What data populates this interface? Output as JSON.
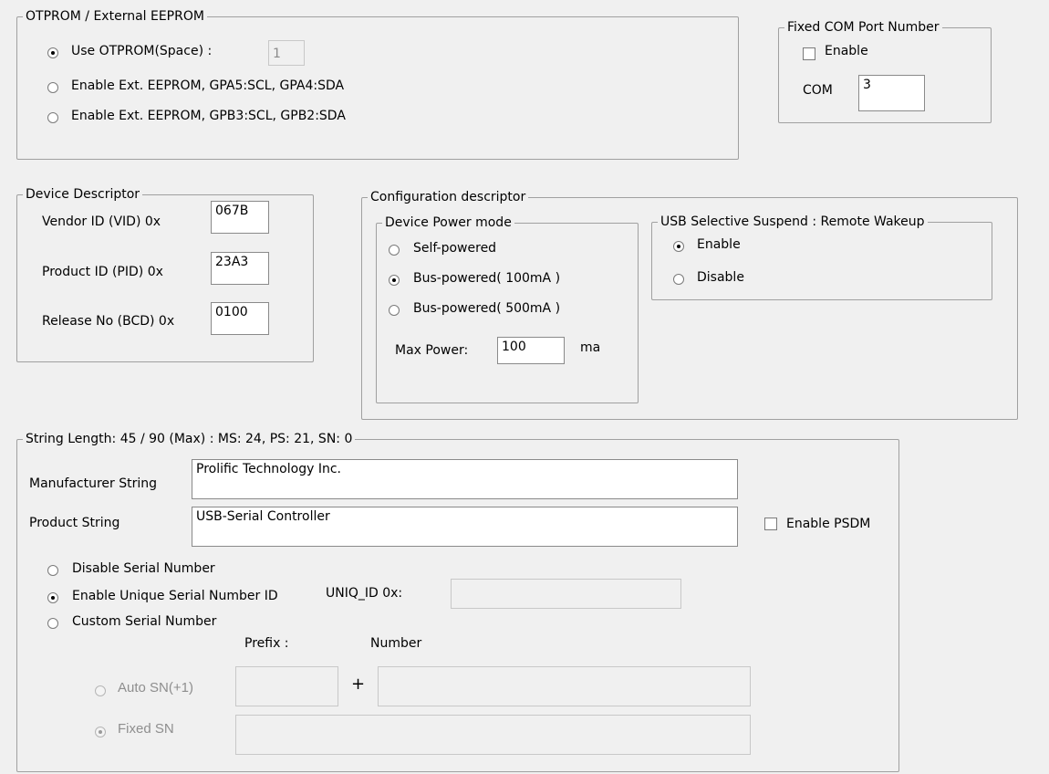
{
  "otprom": {
    "title": "OTPROM / External EEPROM",
    "use_otprom_label": "Use OTPROM(Space) :",
    "space_value": "1",
    "gpa_label": "Enable Ext. EEPROM, GPA5:SCL, GPA4:SDA",
    "gpb_label": "Enable Ext. EEPROM, GPB3:SCL, GPB2:SDA",
    "selected": "use_otprom"
  },
  "com_port": {
    "title": "Fixed COM Port Number",
    "enable_label": "Enable",
    "enabled": false,
    "com_label": "COM",
    "com_value": "3"
  },
  "device_descriptor": {
    "title": "Device Descriptor",
    "vid_label": "Vendor ID (VID)  0x",
    "vid_value": "067B",
    "pid_label": "Product ID (PID)  0x",
    "pid_value": "23A3",
    "bcd_label": "Release No (BCD) 0x",
    "bcd_value": "0100"
  },
  "config_descriptor": {
    "title": "Configuration descriptor",
    "power_mode": {
      "title": "Device Power mode",
      "self_label": "Self-powered",
      "bus100_label": "Bus-powered( 100mA )",
      "bus500_label": "Bus-powered( 500mA )",
      "selected": "bus100",
      "max_power_label": "Max Power:",
      "max_power_value": "100",
      "unit": "ma"
    },
    "suspend": {
      "title": "USB Selective Suspend : Remote Wakeup",
      "enable_label": "Enable",
      "disable_label": "Disable",
      "selected": "enable"
    }
  },
  "strings": {
    "title": "String Length: 45 / 90 (Max) :  MS: 24, PS: 21, SN: 0",
    "manufacturer_label": "Manufacturer String",
    "manufacturer_value": "Prolific Technology Inc.",
    "product_label": "Product String",
    "product_value": "USB-Serial Controller",
    "psdm_label": "Enable PSDM",
    "psdm_enabled": false,
    "serial": {
      "disable_label": "Disable Serial Number",
      "unique_label": "Enable Unique Serial Number ID",
      "uniq_id_label": "UNIQ_ID 0x:",
      "uniq_id_value": "",
      "custom_label": "Custom Serial Number",
      "selected": "unique",
      "prefix_header": "Prefix  :",
      "number_header": "Number",
      "plus": "+",
      "auto_sn_label": "Auto SN(+1)",
      "fixed_sn_label": "Fixed SN",
      "prefix_value": "",
      "number_value": "",
      "fixed_sn_value": ""
    }
  }
}
